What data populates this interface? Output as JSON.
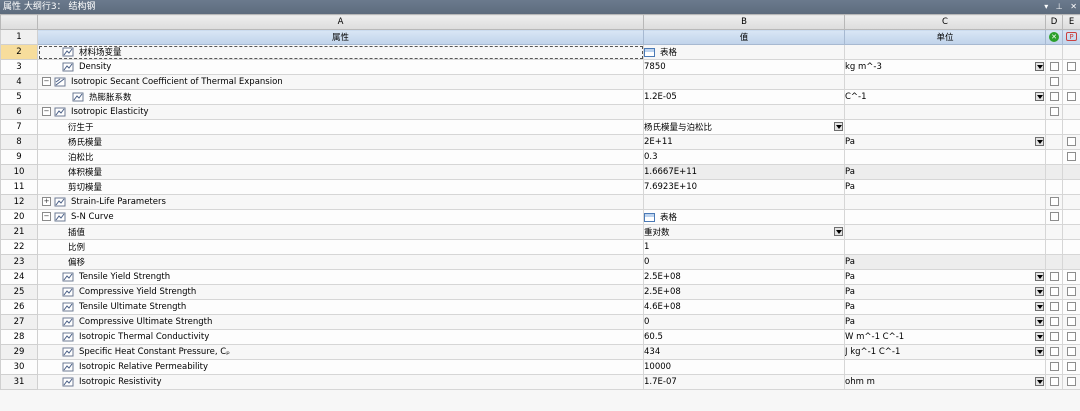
{
  "window": {
    "title": "属性 大纲行3： 结构钢",
    "icons": [
      "▾",
      "⊥",
      "✕"
    ]
  },
  "columns": {
    "A": "A",
    "B": "B",
    "C": "C",
    "D": "D",
    "E": "E"
  },
  "header": {
    "num": "1",
    "property": "属性",
    "value": "值",
    "unit": "单位"
  },
  "rows": [
    {
      "num": "2",
      "indent": 1,
      "exp": "",
      "icon": "material-icon",
      "label": "材料场变量",
      "value": "表格",
      "value_table": true,
      "unit": "",
      "unit_dd": false,
      "d": false,
      "e": false,
      "ro": false,
      "selected": true
    },
    {
      "num": "3",
      "indent": 1,
      "exp": "",
      "icon": "material-icon",
      "label": "Density",
      "value": "7850",
      "unit": "kg m^-3",
      "unit_dd": true,
      "d": true,
      "e": true
    },
    {
      "num": "4",
      "indent": 0,
      "exp": "−",
      "icon": "expansion-icon",
      "label": "Isotropic Secant Coefficient of Thermal Expansion",
      "value": "",
      "unit": "",
      "unit_dd": false,
      "d": true,
      "e": false
    },
    {
      "num": "5",
      "indent": 2,
      "exp": "",
      "icon": "material-icon",
      "label": "热膨胀系数",
      "value": "1.2E-05",
      "unit": "C^-1",
      "unit_dd": true,
      "d": true,
      "e": true
    },
    {
      "num": "6",
      "indent": 0,
      "exp": "−",
      "icon": "material-icon",
      "label": "Isotropic Elasticity",
      "value": "",
      "unit": "",
      "unit_dd": false,
      "d": true,
      "e": false
    },
    {
      "num": "7",
      "indent": 3,
      "exp": "",
      "icon": "",
      "label": "衍生于",
      "value": "杨氏模量与泊松比",
      "value_dd": true,
      "unit": "",
      "unit_dd": false,
      "d": false,
      "e": false
    },
    {
      "num": "8",
      "indent": 3,
      "exp": "",
      "icon": "",
      "label": "杨氏模量",
      "value": "2E+11",
      "unit": "Pa",
      "unit_dd": true,
      "d": false,
      "e": true
    },
    {
      "num": "9",
      "indent": 3,
      "exp": "",
      "icon": "",
      "label": "泊松比",
      "value": "0.3",
      "unit": "",
      "unit_dd": false,
      "d": false,
      "e": true
    },
    {
      "num": "10",
      "indent": 3,
      "exp": "",
      "icon": "",
      "label": "体积模量",
      "value": "1.6667E+11",
      "unit": "Pa",
      "unit_dd": false,
      "d": false,
      "e": false,
      "ro": true
    },
    {
      "num": "11",
      "indent": 3,
      "exp": "",
      "icon": "",
      "label": "剪切模量",
      "value": "7.6923E+10",
      "unit": "Pa",
      "unit_dd": false,
      "d": false,
      "e": false,
      "ro": true
    },
    {
      "num": "12",
      "indent": 0,
      "exp": "+",
      "icon": "material-icon",
      "label": "Strain-Life Parameters",
      "value": "",
      "unit": "",
      "unit_dd": false,
      "d": true,
      "e": false
    },
    {
      "num": "20",
      "indent": 0,
      "exp": "−",
      "icon": "material-icon",
      "label": "S-N Curve",
      "value": "表格",
      "value_table": true,
      "unit": "",
      "unit_dd": false,
      "d": true,
      "e": false
    },
    {
      "num": "21",
      "indent": 3,
      "exp": "",
      "icon": "",
      "label": "插值",
      "value": "重对数",
      "value_dd": true,
      "unit": "",
      "unit_dd": false,
      "d": false,
      "e": false
    },
    {
      "num": "22",
      "indent": 3,
      "exp": "",
      "icon": "",
      "label": "比例",
      "value": "1",
      "unit": "",
      "unit_dd": false,
      "d": false,
      "e": false
    },
    {
      "num": "23",
      "indent": 3,
      "exp": "",
      "icon": "",
      "label": "偏移",
      "value": "0",
      "unit": "Pa",
      "unit_dd": false,
      "d": false,
      "e": false,
      "unit_ro": true
    },
    {
      "num": "24",
      "indent": 1,
      "exp": "",
      "icon": "material-icon",
      "label": "Tensile Yield Strength",
      "value": "2.5E+08",
      "unit": "Pa",
      "unit_dd": true,
      "d": true,
      "e": true
    },
    {
      "num": "25",
      "indent": 1,
      "exp": "",
      "icon": "material-icon",
      "label": "Compressive Yield Strength",
      "value": "2.5E+08",
      "unit": "Pa",
      "unit_dd": true,
      "d": true,
      "e": true
    },
    {
      "num": "26",
      "indent": 1,
      "exp": "",
      "icon": "material-icon",
      "label": "Tensile Ultimate Strength",
      "value": "4.6E+08",
      "unit": "Pa",
      "unit_dd": true,
      "d": true,
      "e": true
    },
    {
      "num": "27",
      "indent": 1,
      "exp": "",
      "icon": "material-icon",
      "label": "Compressive Ultimate Strength",
      "value": "0",
      "unit": "Pa",
      "unit_dd": true,
      "d": true,
      "e": true
    },
    {
      "num": "28",
      "indent": 1,
      "exp": "",
      "icon": "material-icon",
      "label": "Isotropic Thermal Conductivity",
      "value": "60.5",
      "unit": "W m^-1 C^-1",
      "unit_dd": true,
      "d": true,
      "e": true
    },
    {
      "num": "29",
      "indent": 1,
      "exp": "",
      "icon": "material-icon",
      "label": "Specific Heat Constant Pressure, Cₚ",
      "value": "434",
      "unit": "J kg^-1 C^-1",
      "unit_dd": true,
      "d": true,
      "e": true
    },
    {
      "num": "30",
      "indent": 1,
      "exp": "",
      "icon": "material-icon",
      "label": "Isotropic Relative Permeability",
      "value": "10000",
      "unit": "",
      "unit_dd": false,
      "d": true,
      "e": true
    },
    {
      "num": "31",
      "indent": 1,
      "exp": "",
      "icon": "material-icon",
      "label": "Isotropic Resistivity",
      "value": "1.7E-07",
      "unit": "ohm m",
      "unit_dd": true,
      "d": true,
      "e": true
    }
  ],
  "colors": {
    "titlebar": "#5d6b7d",
    "header_blue": "#c0d3ea",
    "selected_rownum": "#f7dd9c",
    "table_icon": "#4a79b5"
  }
}
